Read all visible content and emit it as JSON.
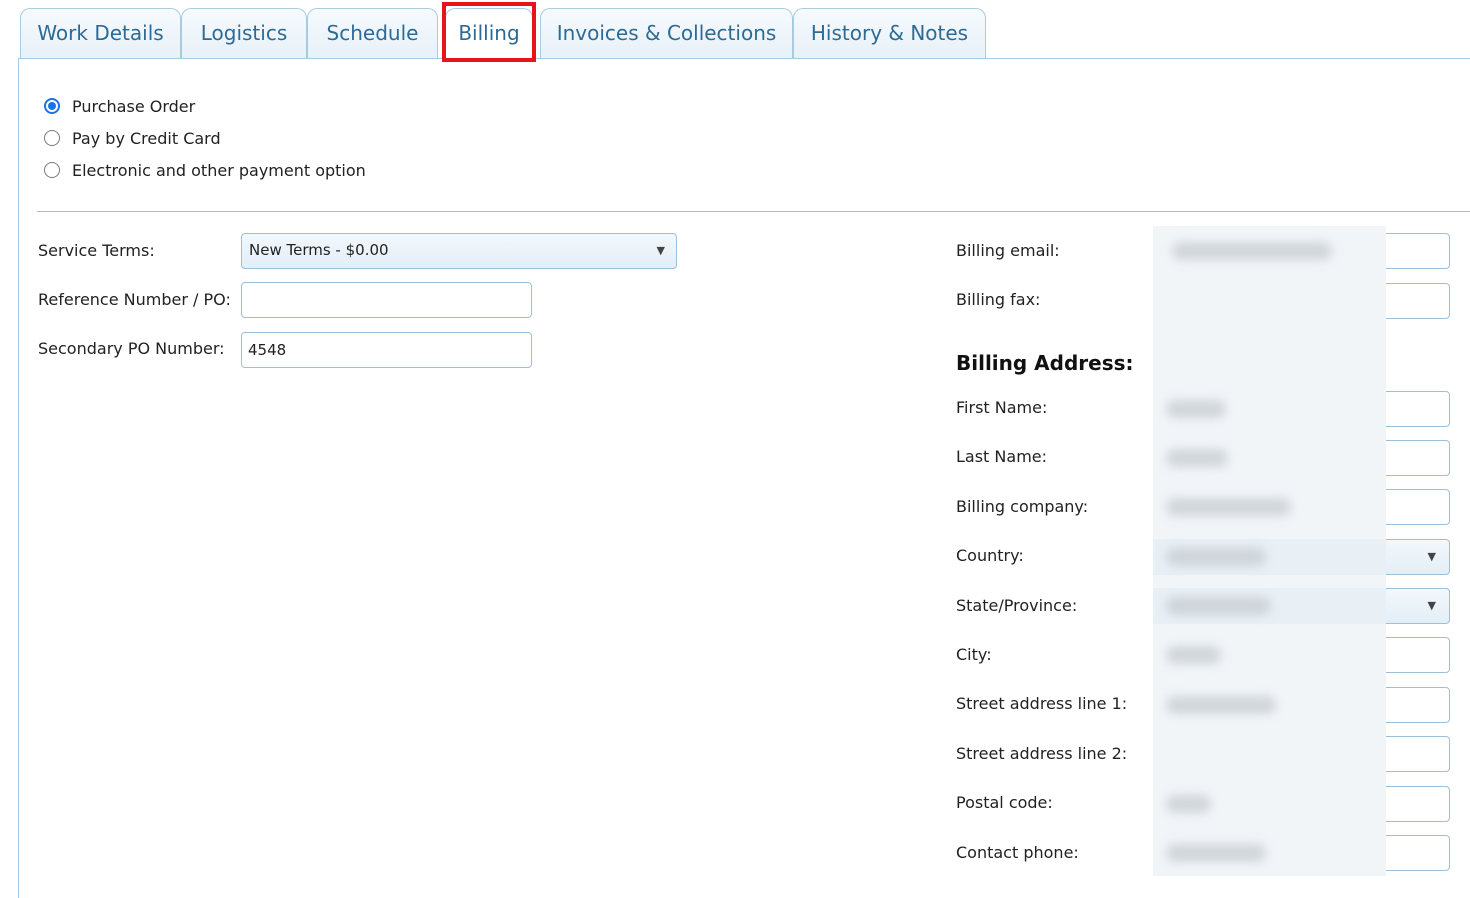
{
  "tabs": [
    {
      "label": "Work Details"
    },
    {
      "label": "Logistics"
    },
    {
      "label": "Schedule"
    },
    {
      "label": "Billing",
      "active": true
    },
    {
      "label": "Invoices & Collections"
    },
    {
      "label": "History & Notes"
    }
  ],
  "payment_options": [
    {
      "label": "Purchase Order",
      "selected": true
    },
    {
      "label": "Pay by Credit Card",
      "selected": false
    },
    {
      "label": "Electronic and other payment option",
      "selected": false
    }
  ],
  "left_form": {
    "service_terms_label": "Service Terms:",
    "service_terms_value": "New Terms - $0.00",
    "reference_label": "Reference Number / PO:",
    "reference_value": "",
    "secondary_po_label": "Secondary PO Number:",
    "secondary_po_value": "4548"
  },
  "right_form": {
    "billing_email_label": "Billing email:",
    "billing_fax_label": "Billing fax:",
    "billing_address_title": "Billing Address:",
    "first_name_label": "First Name:",
    "last_name_label": "Last Name:",
    "billing_company_label": "Billing company:",
    "country_label": "Country:",
    "state_label": "State/Province:",
    "city_label": "City:",
    "street1_label": "Street address line 1:",
    "street2_label": "Street address line 2:",
    "postal_label": "Postal code:",
    "phone_label": "Contact phone:"
  },
  "icons": {
    "dropdown_arrow": "▼"
  },
  "colors": {
    "tab_text": "#2d6b95",
    "border": "#9cc0d6",
    "highlight": "#e8141b",
    "radio_selected": "#1a73e8"
  }
}
